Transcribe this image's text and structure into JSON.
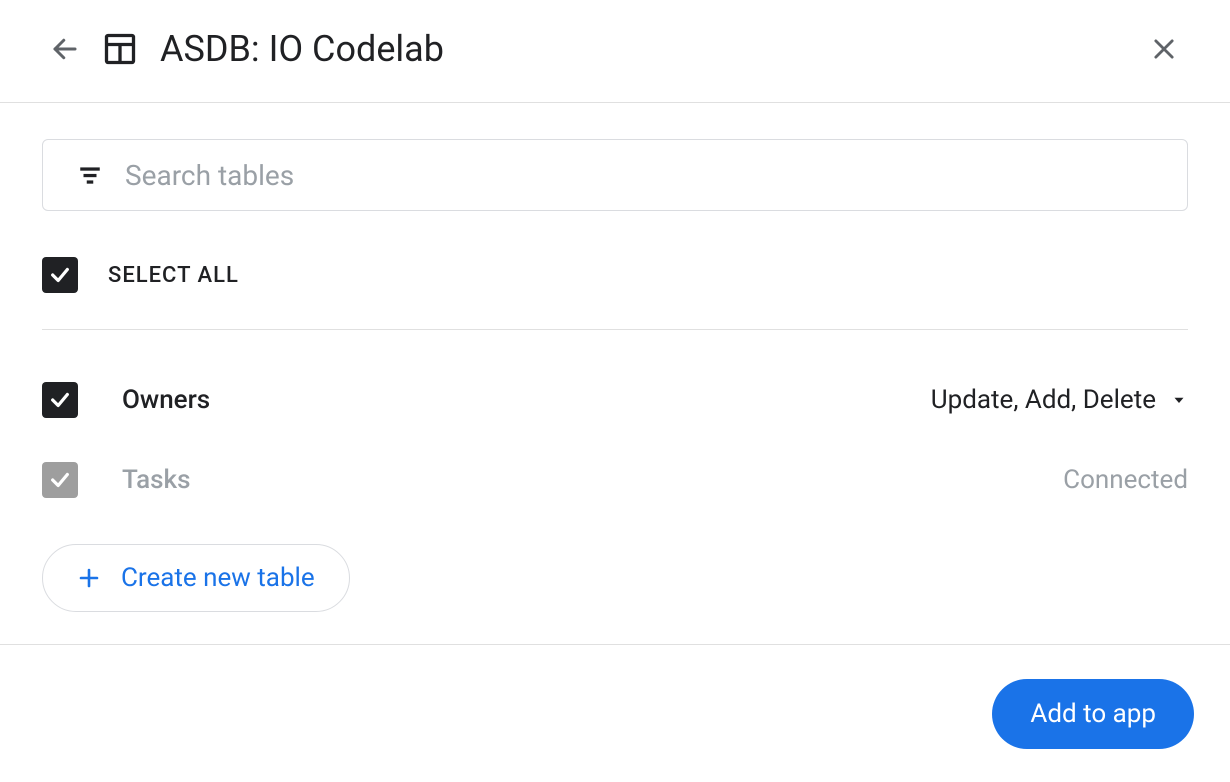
{
  "header": {
    "title": "ASDB: IO Codelab"
  },
  "search": {
    "placeholder": "Search tables"
  },
  "selectAll": {
    "label": "SELECT ALL",
    "checked": true
  },
  "tables": [
    {
      "name": "Owners",
      "status": "Update, Add, Delete",
      "checked": true,
      "muted": false,
      "hasDropdown": true
    },
    {
      "name": "Tasks",
      "status": "Connected",
      "checked": true,
      "muted": true,
      "hasDropdown": false
    }
  ],
  "actions": {
    "createTable": "Create new table",
    "addToApp": "Add to app"
  }
}
